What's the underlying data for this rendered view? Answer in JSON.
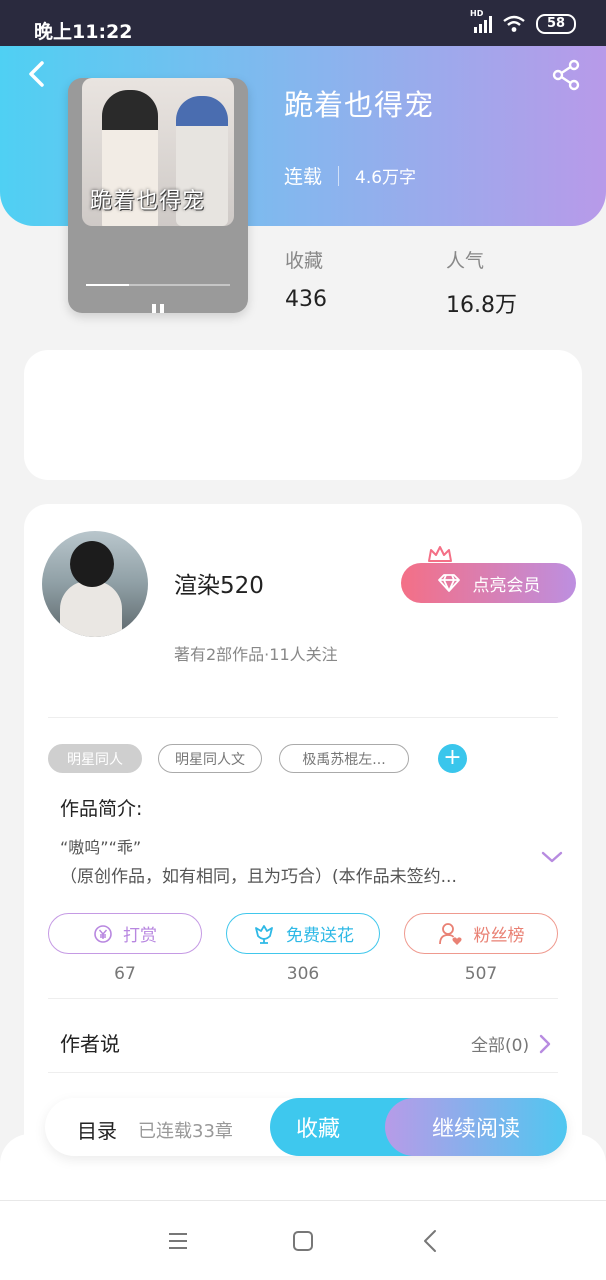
{
  "status_bar": {
    "time": "晚上11:22",
    "network": "HD",
    "battery": "58",
    "icons": [
      "signal-icon",
      "wifi-icon",
      "battery-icon"
    ]
  },
  "header": {
    "icons": [
      "back-icon",
      "share-icon"
    ]
  },
  "book": {
    "cover_title": "跪着也得宠",
    "title": "跪着也得宠",
    "status": "连载",
    "word_count": "4.6万字",
    "stats": [
      {
        "label": "收藏",
        "value": "436"
      },
      {
        "label": "人气",
        "value": "16.8万"
      }
    ]
  },
  "author": {
    "name": "渲染520",
    "summary": "著有2部作品·11人关注",
    "vip_label": "点亮会员"
  },
  "tags": [
    "明星同人",
    "明星同人文",
    "极禹苏棍左..."
  ],
  "intro": {
    "title": "作品简介:",
    "line1": "“嗷呜”“乖”",
    "line2": "（原创作品，如有相同，且为巧合）(本作品未签约..."
  },
  "actions": [
    {
      "label": "打赏",
      "count": "67"
    },
    {
      "label": "免费送花",
      "count": "306"
    },
    {
      "label": "粉丝榜",
      "count": "507"
    }
  ],
  "author_says": {
    "title": "作者说",
    "all_label": "全部(0)"
  },
  "bottom_bar": {
    "toc_label": "目录",
    "chapter_count": "已连载33章",
    "favorite_label": "收藏",
    "read_label": "继续阅读"
  },
  "nav": [
    "menu-icon",
    "home-icon",
    "back-icon"
  ],
  "colors": {
    "accent_cyan": "#3ec8ee",
    "accent_purple": "#b89ae9",
    "vip_pink": "#f46f86"
  }
}
